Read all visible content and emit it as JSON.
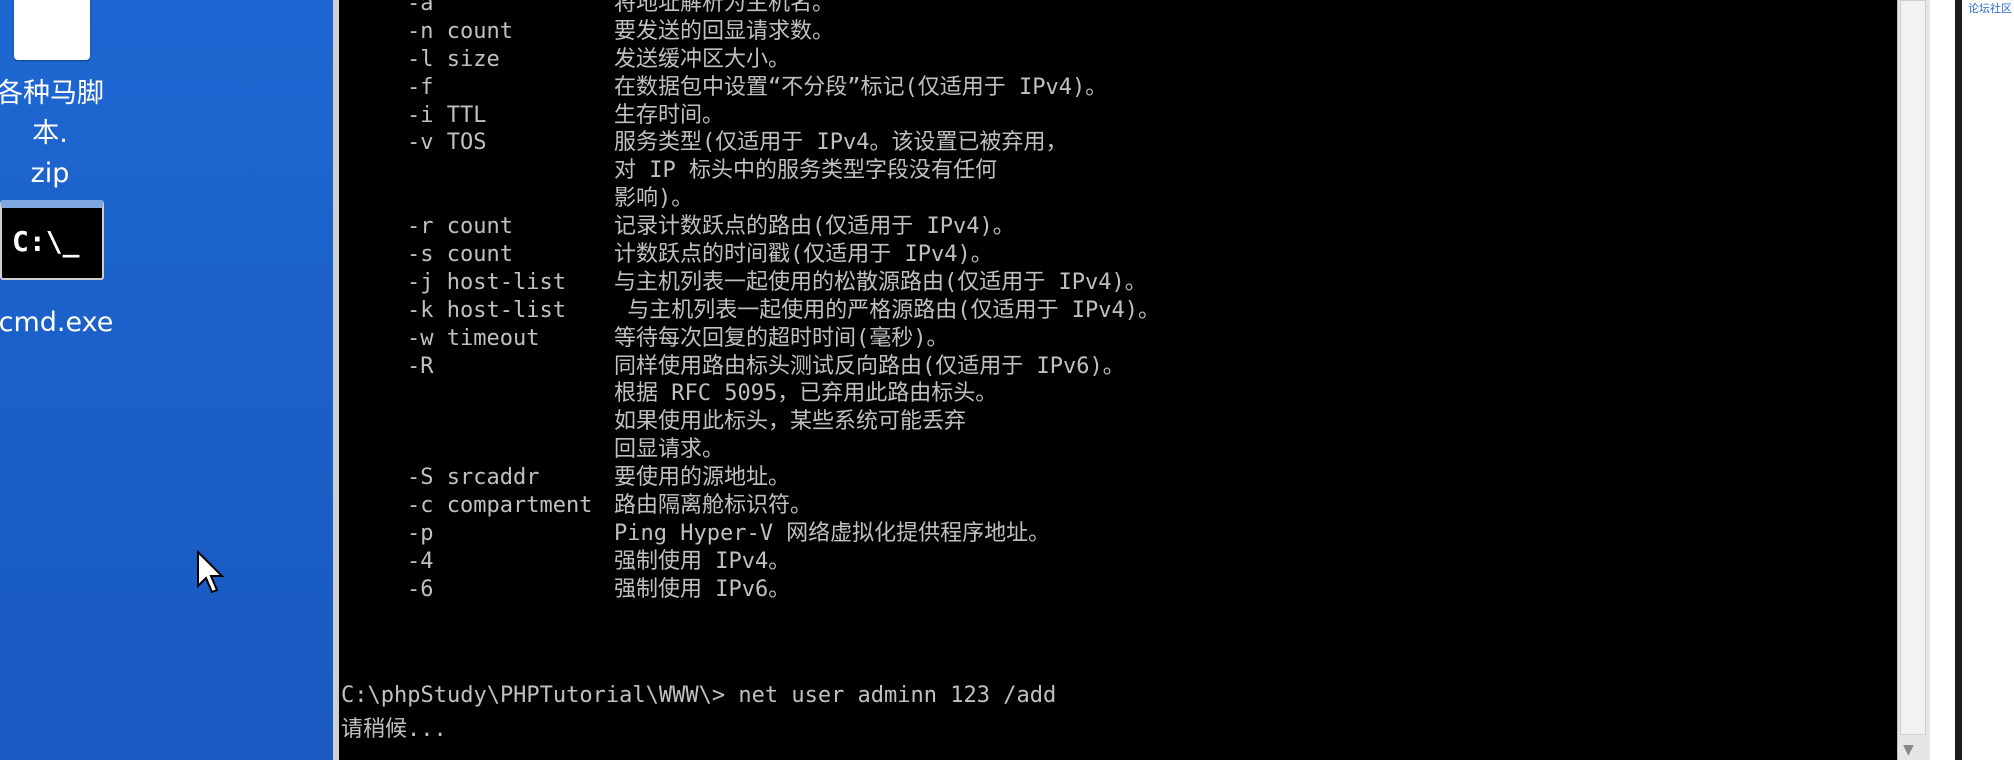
{
  "desktop": {
    "icons": [
      {
        "label_line1": "各种马脚本.",
        "label_line2": "zip",
        "icon": "zip-file-icon"
      },
      {
        "label": "cmd.exe",
        "icon": "cmd-icon",
        "icon_text": "C:\\_"
      }
    ]
  },
  "console": {
    "lines": [
      {
        "opt": "-a",
        "desc": "将地址解析为主机名。"
      },
      {
        "opt": "-n count",
        "desc": "要发送的回显请求数。"
      },
      {
        "opt": "-l size",
        "desc": "发送缓冲区大小。"
      },
      {
        "opt": "-f",
        "desc": "在数据包中设置“不分段”标记(仅适用于 IPv4)。"
      },
      {
        "opt": "-i TTL",
        "desc": "生存时间。"
      },
      {
        "opt": "-v TOS",
        "desc": "服务类型(仅适用于 IPv4。该设置已被弃用，"
      },
      {
        "opt": "",
        "desc": "对 IP 标头中的服务类型字段没有任何"
      },
      {
        "opt": "",
        "desc": "影响)。"
      },
      {
        "opt": "-r count",
        "desc": "记录计数跃点的路由(仅适用于 IPv4)。"
      },
      {
        "opt": "-s count",
        "desc": "计数跃点的时间戳(仅适用于 IPv4)。"
      },
      {
        "opt": "-j host-list",
        "desc": "与主机列表一起使用的松散源路由(仅适用于 IPv4)。"
      },
      {
        "opt": "-k host-list",
        "desc": " 与主机列表一起使用的严格源路由(仅适用于 IPv4)。"
      },
      {
        "opt": "-w timeout",
        "desc": "等待每次回复的超时时间(毫秒)。"
      },
      {
        "opt": "-R",
        "desc": "同样使用路由标头测试反向路由(仅适用于 IPv6)。"
      },
      {
        "opt": "",
        "desc": "根据 RFC 5095，已弃用此路由标头。"
      },
      {
        "opt": "",
        "desc": "如果使用此标头，某些系统可能丢弃"
      },
      {
        "opt": "",
        "desc": "回显请求。"
      },
      {
        "opt": "-S srcaddr",
        "desc": "要使用的源地址。"
      },
      {
        "opt": "-c compartment",
        "desc": "路由隔离舱标识符。"
      },
      {
        "opt": "-p",
        "desc": "Ping Hyper-V 网络虚拟化提供程序地址。"
      },
      {
        "opt": "-4",
        "desc": "强制使用 IPv4。"
      },
      {
        "opt": "-6",
        "desc": "强制使用 IPv6。"
      }
    ],
    "prompt": "C:\\phpStudy\\PHPTutorial\\WWW\\> net user adminn 123 /add",
    "status": "请稍候..."
  },
  "right_strip": {
    "corner_text": "论坛社区"
  },
  "colors": {
    "desktop_bg": "#1e67d2",
    "console_bg": "#000000",
    "console_fg": "#c0c0c0"
  }
}
